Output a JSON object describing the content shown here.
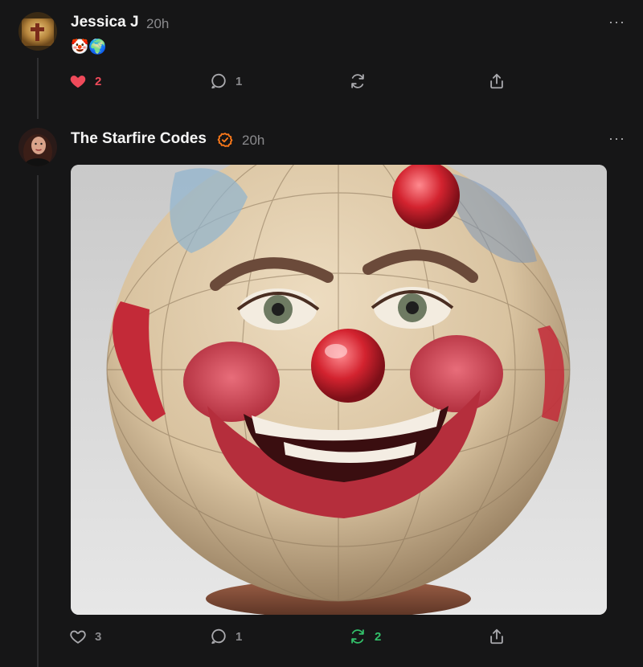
{
  "posts": [
    {
      "username": "Jessica J",
      "time": "20h",
      "content": "🤡🌍",
      "likes": "2",
      "liked": true,
      "comments": "1",
      "reposts": "",
      "more": "···"
    },
    {
      "username": "The Starfire Codes",
      "verified": true,
      "time": "20h",
      "image_alt": "clown-faced globe",
      "likes": "3",
      "liked": false,
      "comments": "1",
      "reposts": "2",
      "reposted": true,
      "more": "···"
    }
  ],
  "colors": {
    "background": "#161617",
    "like_active": "#ef4a5a",
    "repost_active": "#33c06a",
    "verified": "#ff7a1a",
    "muted": "#8a8a8d"
  }
}
